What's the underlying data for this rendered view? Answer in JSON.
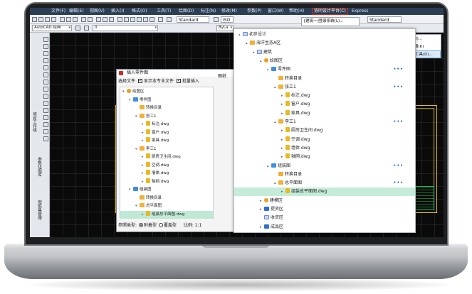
{
  "menubar": {
    "items": [
      "文件(F)",
      "编辑(E)",
      "视图(V)",
      "插入(I)",
      "格式(O)",
      "工具(T)",
      "绘图(D)",
      "标注(N)",
      "修改(M)",
      "参数(P)",
      "窗口(W)",
      "帮助(H)",
      "协同设计平台(C)",
      "Express"
    ]
  },
  "toolbar": {
    "workspace": "AutoCAD 经典",
    "layer": "0",
    "style1": "Standard",
    "style2": "ISO",
    "style3": "Standard",
    "bylayer": "ByLa"
  },
  "cascade_menu": {
    "item": "[建筑一]登录系统(L)..."
  },
  "submenu": {
    "items": [
      "插入图框工具(I)...",
      "图签属性编辑器(K)",
      "生成图纸目录工具(D)..."
    ]
  },
  "left_palette": {
    "labels": [
      "项目工作组",
      "参数化图库",
      "图纸集管理"
    ]
  },
  "dialog": {
    "title": "插入零件图",
    "select_file": "选择文件",
    "show_major": "显示本专业文件",
    "batch_insert": "批量插入",
    "preview_tab": "图纸",
    "tree": [
      {
        "label": "绘图区",
        "icon": "gold",
        "depth": 0,
        "arrow": "▾"
      },
      {
        "label": "零件图",
        "icon": "box",
        "depth": 1,
        "arrow": "▾"
      },
      {
        "label": "转换目录",
        "icon": "folder",
        "depth": 2,
        "arrow": ""
      },
      {
        "label": "张工1",
        "icon": "folder",
        "depth": 2,
        "arrow": "▾"
      },
      {
        "label": "标注.dwg",
        "icon": "dwg",
        "depth": 3,
        "arrow": "▸"
      },
      {
        "label": "窗户.dwg",
        "icon": "dwg",
        "depth": 3,
        "arrow": "▸"
      },
      {
        "label": "家具.dwg",
        "icon": "dwg",
        "depth": 3,
        "arrow": "▸"
      },
      {
        "label": "李工1",
        "icon": "folder",
        "depth": 2,
        "arrow": "▾"
      },
      {
        "label": "厨房卫生间.dwg",
        "icon": "dwg",
        "depth": 3,
        "arrow": "▸"
      },
      {
        "label": "空调.dwg",
        "icon": "dwg",
        "depth": 3,
        "arrow": "▸"
      },
      {
        "label": "墙体.dwg",
        "icon": "dwg",
        "depth": 3,
        "arrow": "▸"
      },
      {
        "label": "轴网.dwg",
        "icon": "dwg",
        "depth": 3,
        "arrow": "▸"
      },
      {
        "label": "组装图",
        "icon": "box",
        "depth": 1,
        "arrow": "▾"
      },
      {
        "label": "转换目录",
        "icon": "folder",
        "depth": 2,
        "arrow": ""
      },
      {
        "label": "总平面图",
        "icon": "folder",
        "depth": 2,
        "arrow": "▾"
      },
      {
        "label": "组装总平面图.dwg",
        "icon": "dwg",
        "depth": 3,
        "arrow": "▸",
        "selected": true
      }
    ],
    "ref_type_label": "参照类型:",
    "attach": "附着型",
    "overlay": "覆盖型",
    "scale_label": "比例:",
    "scale_value": "1:1"
  },
  "panel": {
    "tree": [
      {
        "label": "初步设计",
        "icon": "sq",
        "depth": 0,
        "arrow": "▴",
        "dots": false
      },
      {
        "label": "海洋生态A区",
        "icon": "folder",
        "depth": 1,
        "arrow": "▴",
        "dots": false
      },
      {
        "label": "建筑",
        "icon": "sq",
        "depth": 2,
        "arrow": "▴",
        "dots": false
      },
      {
        "label": "绘图区",
        "icon": "gold",
        "depth": 3,
        "arrow": "▴",
        "dots": false
      },
      {
        "label": "零件图",
        "icon": "box",
        "depth": 4,
        "arrow": "▴",
        "dots": true
      },
      {
        "label": "转换目录",
        "icon": "folder",
        "depth": 5,
        "arrow": "",
        "dots": false
      },
      {
        "label": "张工1",
        "icon": "folder",
        "depth": 5,
        "arrow": "▴",
        "dots": true
      },
      {
        "label": "标注.dwg",
        "icon": "dwg",
        "depth": 6,
        "arrow": "▸",
        "dots": false
      },
      {
        "label": "窗户.dwg",
        "icon": "dwg",
        "depth": 6,
        "arrow": "▸",
        "dots": false
      },
      {
        "label": "家具.dwg",
        "icon": "dwg",
        "depth": 6,
        "arrow": "▸",
        "dots": false
      },
      {
        "label": "李工1",
        "icon": "folder",
        "depth": 5,
        "arrow": "▴",
        "dots": true
      },
      {
        "label": "厨房卫生间.dwg",
        "icon": "dwg",
        "depth": 6,
        "arrow": "▸",
        "dots": false
      },
      {
        "label": "空调.dwg",
        "icon": "dwg",
        "depth": 6,
        "arrow": "▸",
        "dots": false
      },
      {
        "label": "墙体.dwg",
        "icon": "dwg",
        "depth": 6,
        "arrow": "▸",
        "dots": false
      },
      {
        "label": "轴网.dwg",
        "icon": "dwg",
        "depth": 6,
        "arrow": "▸",
        "dots": false
      },
      {
        "label": "组装图",
        "icon": "box",
        "depth": 4,
        "arrow": "▴",
        "dots": true
      },
      {
        "label": "转换目录",
        "icon": "folder",
        "depth": 5,
        "arrow": "",
        "dots": false
      },
      {
        "label": "总平面图",
        "icon": "folder",
        "depth": 5,
        "arrow": "▴",
        "dots": true
      },
      {
        "label": "组装总平面图.dwg",
        "icon": "dwg",
        "depth": 6,
        "arrow": "▸",
        "dots": false,
        "selected": true
      },
      {
        "label": "建模区",
        "icon": "gold",
        "depth": 3,
        "arrow": "▸",
        "dots": false
      },
      {
        "label": "提资区",
        "icon": "blue",
        "depth": 3,
        "arrow": "▸",
        "dots": false
      },
      {
        "label": "收资区",
        "icon": "sq",
        "depth": 3,
        "arrow": "",
        "dots": false
      },
      {
        "label": "成品区",
        "icon": "blue",
        "depth": 3,
        "arrow": "▸",
        "dots": false
      }
    ]
  },
  "colors": {
    "menubar": "#2c3e56",
    "highlight": "#c5ecd9",
    "accent_red": "#d4281e",
    "frame": "#e8c01e"
  }
}
